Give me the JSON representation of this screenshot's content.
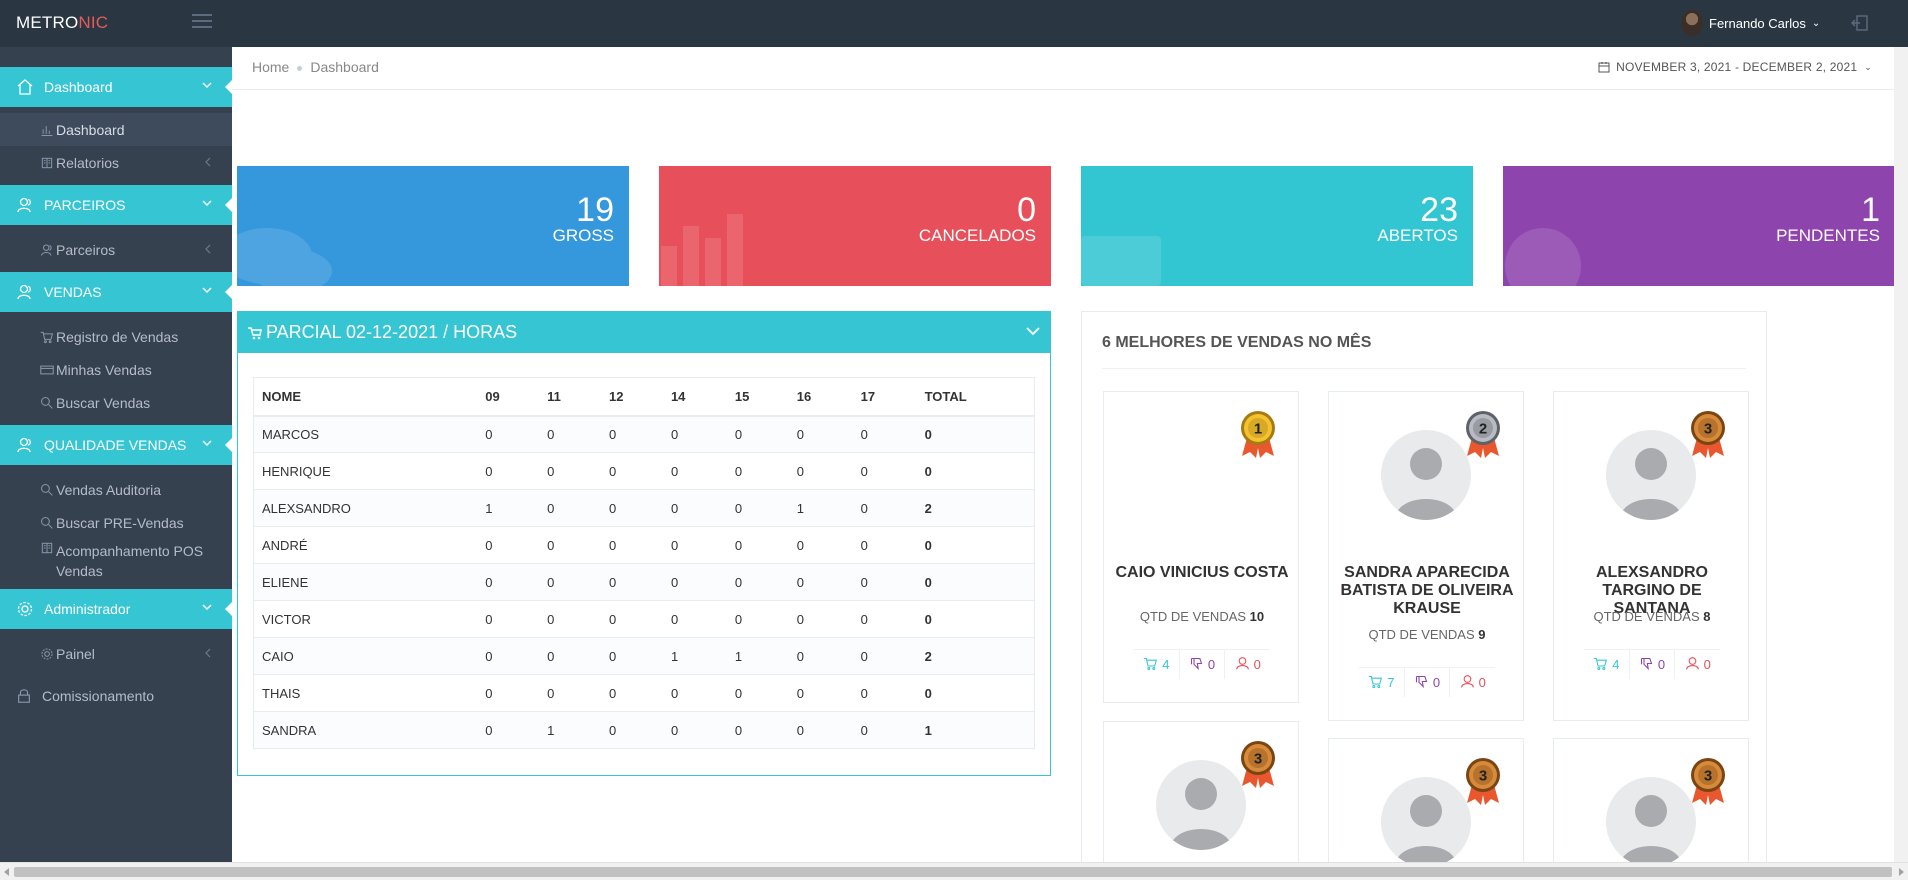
{
  "app": {
    "logo_part1": "METRO",
    "logo_part2": "NIC",
    "user_name": "Fernando Carlos"
  },
  "sidebar": {
    "sections": [
      {
        "label": "Dashboard",
        "icon": "home-icon",
        "items": [
          {
            "label": "Dashboard",
            "icon": "bar-chart-icon",
            "active": true
          },
          {
            "label": "Relatorios",
            "icon": "book-icon"
          }
        ]
      },
      {
        "label": "PARCEIROS",
        "icon": "users-icon",
        "items": [
          {
            "label": "Parceiros",
            "icon": "users-icon"
          }
        ]
      },
      {
        "label": "VENDAS",
        "icon": "users-icon",
        "items": [
          {
            "label": "Registro de Vendas",
            "icon": "cart-icon"
          },
          {
            "label": "Minhas Vendas",
            "icon": "credit-card-icon"
          },
          {
            "label": "Buscar Vendas",
            "icon": "search-icon"
          }
        ]
      },
      {
        "label": "QUALIDADE VENDAS",
        "icon": "users-icon",
        "items": [
          {
            "label": "Vendas Auditoria",
            "icon": "search-icon"
          },
          {
            "label": "Buscar PRE-Vendas",
            "icon": "search-icon"
          },
          {
            "label": "Acompanhamento POS Vendas",
            "icon": "book-icon"
          }
        ]
      },
      {
        "label": "Administrador",
        "icon": "gear-icon",
        "items": [
          {
            "label": "Painel",
            "icon": "gear-icon"
          }
        ]
      }
    ],
    "footer_item": "Comissionamento"
  },
  "breadcrumb": {
    "home": "Home",
    "current": "Dashboard"
  },
  "date_range": "NOVEMBER 3, 2021 - DECEMBER 2, 2021",
  "tiles": [
    {
      "value": "19",
      "label": "GROSS",
      "color": "#3598dc"
    },
    {
      "value": "0",
      "label": "CANCELADOS",
      "color": "#e7505a"
    },
    {
      "value": "23",
      "label": "ABERTOS",
      "color": "#32c5d2"
    },
    {
      "value": "1",
      "label": "PENDENTES",
      "color": "#8e44ad"
    }
  ],
  "partial": {
    "title": "PARCIAL 02-12-2021 / HORAS",
    "headers": [
      "NOME",
      "09",
      "11",
      "12",
      "14",
      "15",
      "16",
      "17",
      "TOTAL"
    ],
    "rows": [
      [
        "MARCOS",
        "0",
        "0",
        "0",
        "0",
        "0",
        "0",
        "0",
        "0"
      ],
      [
        "HENRIQUE",
        "0",
        "0",
        "0",
        "0",
        "0",
        "0",
        "0",
        "0"
      ],
      [
        "ALEXSANDRO",
        "1",
        "0",
        "0",
        "0",
        "0",
        "1",
        "0",
        "2"
      ],
      [
        "ANDRÉ",
        "0",
        "0",
        "0",
        "0",
        "0",
        "0",
        "0",
        "0"
      ],
      [
        "ELIENE",
        "0",
        "0",
        "0",
        "0",
        "0",
        "0",
        "0",
        "0"
      ],
      [
        "VICTOR",
        "0",
        "0",
        "0",
        "0",
        "0",
        "0",
        "0",
        "0"
      ],
      [
        "CAIO",
        "0",
        "0",
        "0",
        "1",
        "1",
        "0",
        "0",
        "2"
      ],
      [
        "THAIS",
        "0",
        "0",
        "0",
        "0",
        "0",
        "0",
        "0",
        "0"
      ],
      [
        "SANDRA",
        "0",
        "1",
        "0",
        "0",
        "0",
        "0",
        "0",
        "1"
      ]
    ]
  },
  "sellers": {
    "title": "6 MELHORES DE VENDAS NO MÊS",
    "qty_label": "QTD DE VENDAS",
    "cards": [
      {
        "rank": "1",
        "medal": "gold-medal-icon",
        "name": "CAIO VINICIUS COSTA",
        "qty": "10",
        "cart": "4",
        "dislike": "0",
        "user": "0",
        "has_avatar": false
      },
      {
        "rank": "2",
        "medal": "silver-medal-icon",
        "name": "SANDRA APARECIDA BATISTA DE OLIVEIRA KRAUSE",
        "qty": "9",
        "cart": "7",
        "dislike": "0",
        "user": "0",
        "has_avatar": true
      },
      {
        "rank": "3",
        "medal": "bronze-medal-icon",
        "name": "ALEXSANDRO TARGINO DE SANTANA",
        "qty": "8",
        "cart": "4",
        "dislike": "0",
        "user": "0",
        "has_avatar": true
      },
      {
        "rank": "3",
        "medal": "bronze-medal-icon"
      },
      {
        "rank": "3",
        "medal": "bronze-medal-icon"
      },
      {
        "rank": "3",
        "medal": "bronze-medal-icon"
      }
    ]
  }
}
